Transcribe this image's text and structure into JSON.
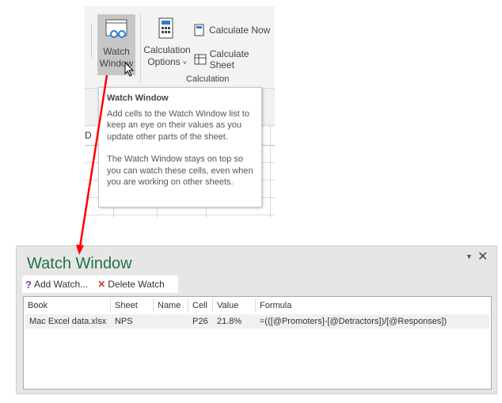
{
  "ribbon": {
    "watch_window_label_1": "Watch",
    "watch_window_label_2": "Window",
    "calc_options_1": "Calculation",
    "calc_options_2": "Options",
    "calculate_now": "Calculate Now",
    "calculate_sheet": "Calculate Sheet",
    "group_label": "Calculation",
    "column_partial": "D"
  },
  "tooltip": {
    "title": "Watch Window",
    "p1": "Add cells to the Watch Window list to keep an eye on their values as you update other parts of the sheet.",
    "p2": "The Watch Window stays on top so you can watch these cells, even when you are working on other sheets."
  },
  "watch_window": {
    "title": "Watch Window",
    "add_watch": "Add Watch...",
    "delete_watch": "Delete Watch",
    "columns": [
      "Book",
      "Sheet",
      "Name",
      "Cell",
      "Value",
      "Formula"
    ],
    "rows": [
      [
        "Mac Excel data.xlsx",
        "NPS",
        "",
        "P26",
        "21.8%",
        "=(([@Promoters]-[@Detractors])/[@Responses])"
      ]
    ]
  },
  "colors": {
    "title_green": "#217346",
    "arrow_red": "#ff0000"
  }
}
